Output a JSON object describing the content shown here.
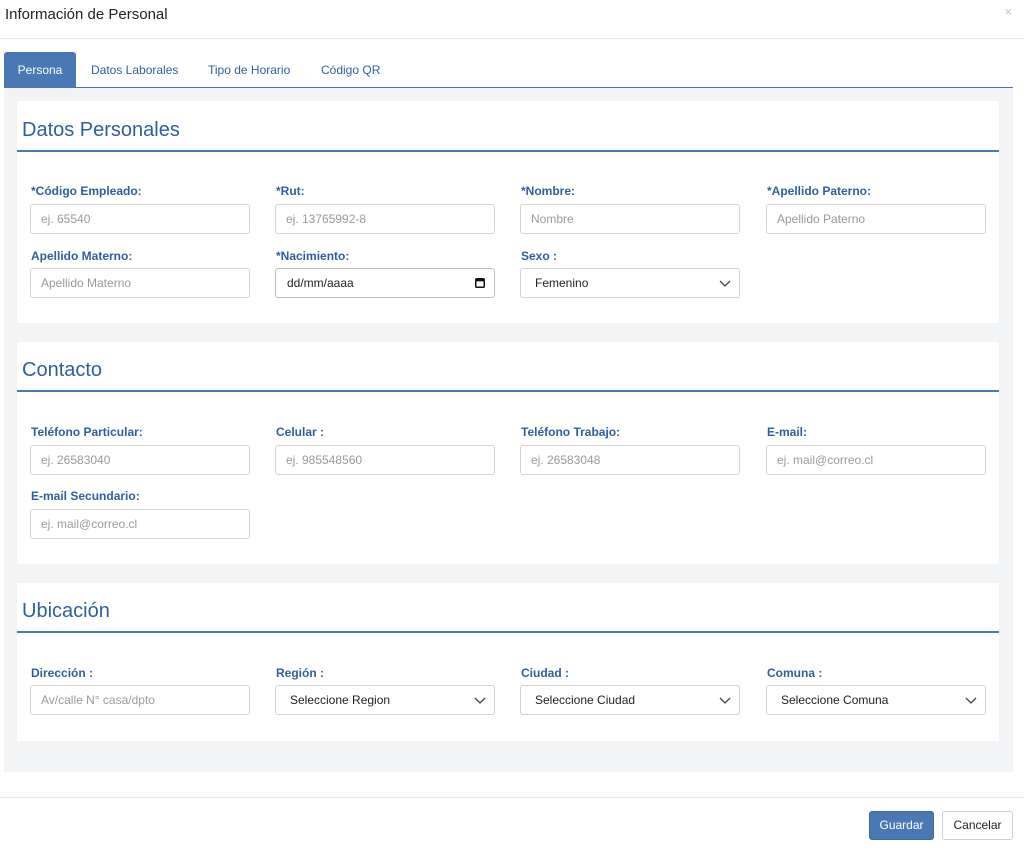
{
  "modal": {
    "title": "Información de Personal",
    "close": "×"
  },
  "tabs": [
    {
      "label": "Persona",
      "active": true
    },
    {
      "label": "Datos Laborales",
      "active": false
    },
    {
      "label": "Tipo de Horario",
      "active": false
    },
    {
      "label": "Código QR",
      "active": false
    }
  ],
  "datos_personales": {
    "title": "Datos Personales",
    "codigo": {
      "label": "*Código Empleado:",
      "placeholder": "ej. 65540"
    },
    "rut": {
      "label": "*Rut:",
      "placeholder": "ej. 13765992-8"
    },
    "nombre": {
      "label": "*Nombre:",
      "placeholder": "Nombre"
    },
    "apellido_paterno": {
      "label": "*Apellido Paterno:",
      "placeholder": "Apellido Paterno"
    },
    "apellido_materno": {
      "label": "Apellido Materno:",
      "placeholder": "Apellido Materno"
    },
    "nacimiento": {
      "label": "*Nacimiento:",
      "value": "dd/mm/aaaa"
    },
    "sexo": {
      "label": "Sexo :",
      "value": "Femenino"
    }
  },
  "contacto": {
    "title": "Contacto",
    "telefono_particular": {
      "label": "Teléfono Particular:",
      "placeholder": "ej. 26583040"
    },
    "celular": {
      "label": "Celular :",
      "placeholder": "ej. 985548560"
    },
    "telefono_trabajo": {
      "label": "Teléfono Trabajo:",
      "placeholder": "ej. 26583048"
    },
    "email": {
      "label": "E-mail:",
      "placeholder": "ej. mail@correo.cl"
    },
    "email_secundario": {
      "label": "E-mail Secundario:",
      "placeholder": "ej. mail@correo.cl"
    }
  },
  "ubicacion": {
    "title": "Ubicación",
    "direccion": {
      "label": "Dirección :",
      "placeholder": "Av/calle N° casa/dpto"
    },
    "region": {
      "label": "Región :",
      "value": "Seleccione Region"
    },
    "ciudad": {
      "label": "Ciudad :",
      "value": "Seleccione Ciudad"
    },
    "comuna": {
      "label": "Comuna :",
      "value": "Seleccione Comuna"
    }
  },
  "footer": {
    "save": "Guardar",
    "cancel": "Cancelar"
  },
  "colors": {
    "accent": "#4a78b5",
    "label": "#2f5fa0",
    "panel_bg": "#f3f4f6"
  }
}
